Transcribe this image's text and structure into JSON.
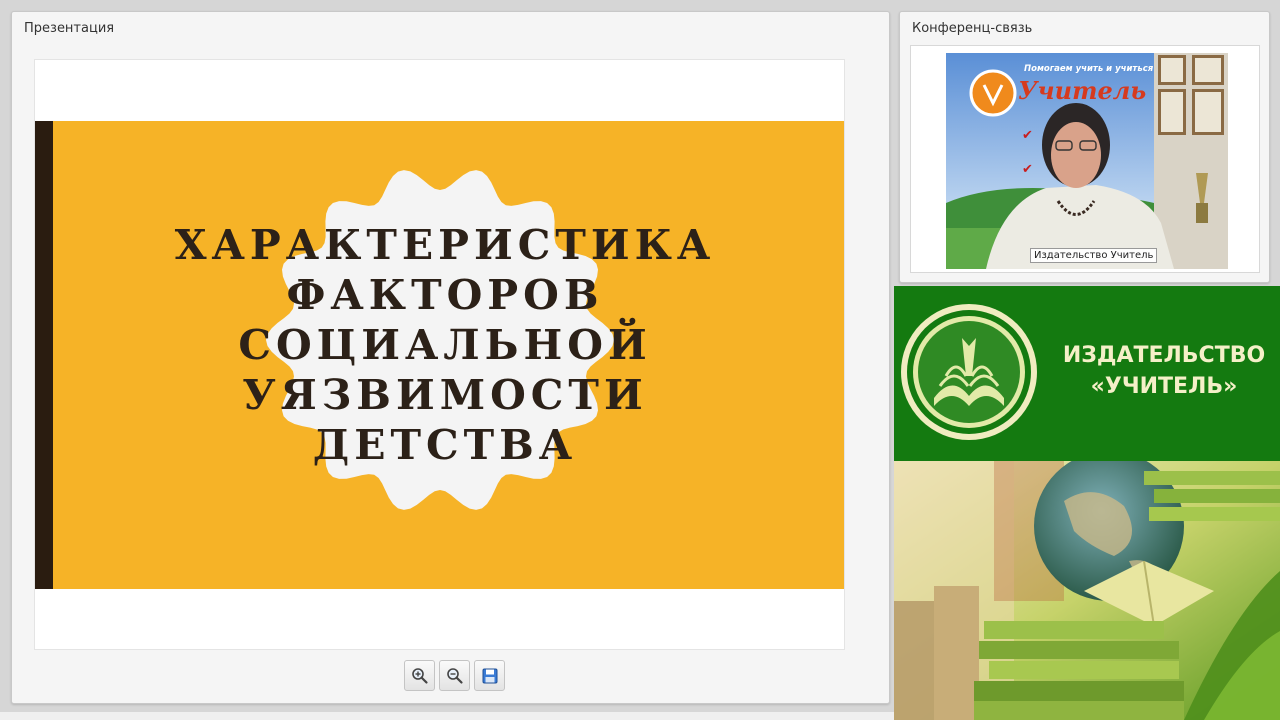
{
  "presentation": {
    "title": "Презентация",
    "slide": {
      "title_lines": [
        "ХАРАКТЕРИСТИКА",
        "ФАКТОРОВ",
        "СОЦИАЛЬНОЙ",
        "УЯЗВИМОСТИ",
        "ДЕТСТВА"
      ]
    },
    "toolbar": {
      "zoom_in_icon": "zoom-in-icon",
      "zoom_out_icon": "zoom-out-icon",
      "save_icon": "save-icon"
    }
  },
  "conference": {
    "title": "Конференц-связь",
    "participant_label": "Издательство Учитель",
    "backdrop_slogan": "Помогаем учить и учиться",
    "backdrop_brand": "Учитель"
  },
  "banner": {
    "line1": "ИЗДАТЕЛЬСТВО",
    "line2": "«УЧИТЕЛЬ»"
  },
  "colors": {
    "slide_band": "#f6b327",
    "slide_bar": "#2a1c10",
    "banner_green": "#147a10",
    "banner_text": "#f5f0c8"
  }
}
